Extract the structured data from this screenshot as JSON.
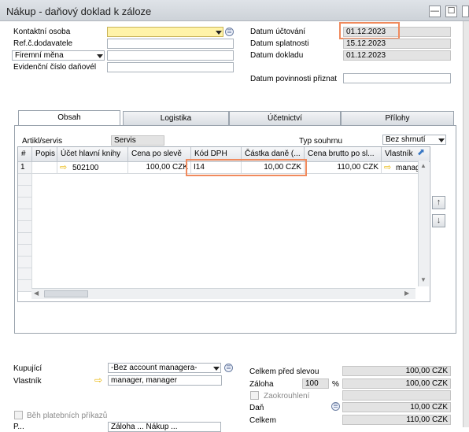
{
  "window": {
    "title": "Nákup - daňový doklad k záloze",
    "btn_minimize": "—",
    "btn_maximize": "☐",
    "btn_close": "✕"
  },
  "header_left": {
    "contact_label": "Kontaktní osoba",
    "contact_value": "",
    "vendor_ref_label": "Ref.č.dodavatele",
    "vendor_ref_value": "",
    "currency_select": "Firemní měna",
    "currency_value": "",
    "tax_doc_label": "Evidenční číslo daňovél",
    "tax_doc_value": ""
  },
  "header_right": {
    "posting_date_label": "Datum účtování",
    "posting_date_value": "01.12.2023",
    "due_date_label": "Datum splatnosti",
    "due_date_value": "15.12.2023",
    "doc_date_label": "Datum dokladu",
    "doc_date_value": "01.12.2023",
    "tax_date_label": "Datum povinnosti přiznat",
    "tax_date_value": ""
  },
  "tabs": [
    "Obsah",
    "Logistika",
    "Účetnictví",
    "Přílohy"
  ],
  "content": {
    "item_service_label": "Artikl/servis",
    "item_service_value": "Servis",
    "summary_type_label": "Typ souhrnu",
    "summary_type_value": "Bez shrnutí"
  },
  "grid": {
    "columns": [
      "#",
      "Popis",
      "Účet hlavní knihy",
      "Cena po slevě",
      "Kód DPH",
      "Částka daně (...",
      "Cena brutto po sl...",
      "Vlastník"
    ],
    "rows": [
      {
        "num": "1",
        "desc": "",
        "gl_account": "502100",
        "price_after_discount": "100,00 CZK",
        "tax_code": "I14",
        "tax_amount": "10,00 CZK",
        "gross_price": "110,00 CZK",
        "owner": "manag"
      }
    ]
  },
  "footer_left": {
    "buyer_label": "Kupující",
    "buyer_value": "-Bez account managera-",
    "owner_label": "Vlastník",
    "owner_value": "manager, manager",
    "payment_orders_label": "Běh platebních příkazů",
    "cut_label": "P...",
    "cut_value": "Záloha ... Nákup ..."
  },
  "footer_right": {
    "total_before_label": "Celkem před slevou",
    "total_before_value": "100,00 CZK",
    "advance_label": "Záloha",
    "advance_pct": "100",
    "pct_sign": "%",
    "advance_value": "100,00 CZK",
    "rounding_label": "Zaokrouhlení",
    "rounding_value": "",
    "tax_label": "Daň",
    "tax_value": "10,00 CZK",
    "total_label": "Celkem",
    "total_value": "110,00 CZK"
  }
}
